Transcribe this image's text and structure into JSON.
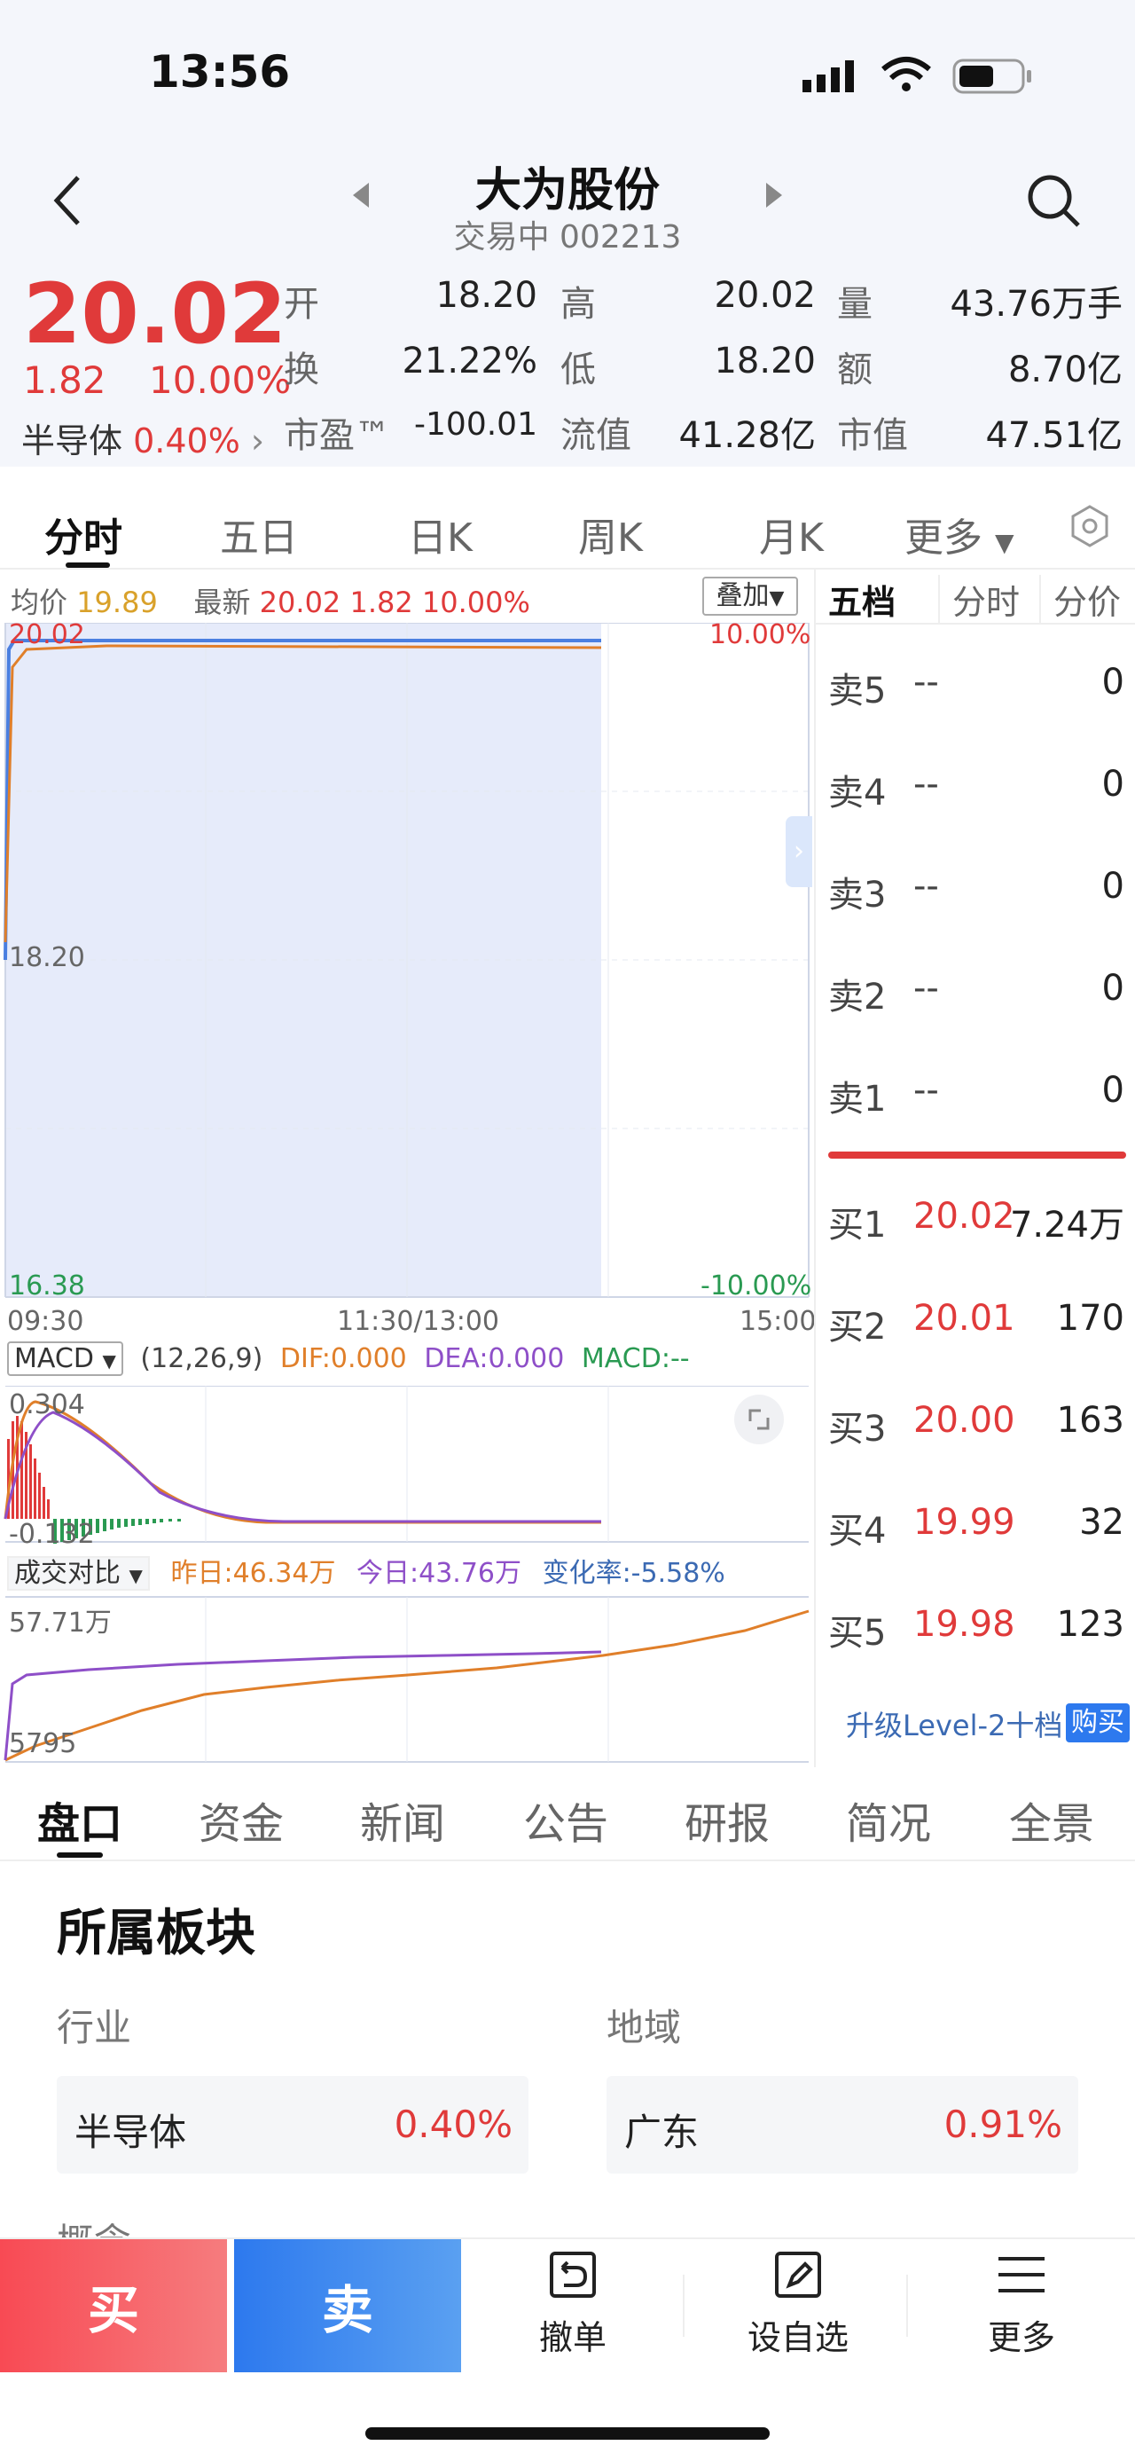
{
  "status": {
    "time": "13:56"
  },
  "nav": {
    "title": "大为股份",
    "subtitle": "交易中 002213"
  },
  "quote": {
    "price": "20.02",
    "change": "1.82",
    "change_pct": "10.00%",
    "sector_name": "半导体",
    "sector_pct": "0.40%",
    "stats": [
      {
        "label": "开",
        "value": "18.20"
      },
      {
        "label": "高",
        "value": "20.02"
      },
      {
        "label": "量",
        "value": "43.76万手"
      },
      {
        "label": "换",
        "value": "21.22%"
      },
      {
        "label": "低",
        "value": "18.20"
      },
      {
        "label": "额",
        "value": "8.70亿"
      },
      {
        "label": "市盈™",
        "value": "-100.01"
      },
      {
        "label": "流值",
        "value": "41.28亿"
      },
      {
        "label": "市值",
        "value": "47.51亿"
      }
    ]
  },
  "tabs": [
    "分时",
    "五日",
    "日K",
    "周K",
    "月K",
    "更多"
  ],
  "chart": {
    "avg_label": "均价",
    "avg_value": "19.89",
    "latest_label": "最新",
    "latest_value": "20.02",
    "latest_change": "1.82",
    "latest_pct": "10.00%",
    "overlay_btn": "叠加",
    "top_price": "20.02",
    "mid_price": "18.20",
    "low_price": "16.38",
    "top_pct": "10.00%",
    "low_pct": "-10.00%",
    "time_ticks": [
      "09:30",
      "11:30/13:00",
      "15:00"
    ],
    "macd": {
      "label": "MACD",
      "params": "(12,26,9)",
      "dif": "DIF:0.000",
      "dea": "DEA:0.000",
      "macd": "MACD:--",
      "top": "0.304",
      "bottom": "-0.132"
    },
    "volcmp": {
      "label": "成交对比",
      "yesterday": "昨日:46.34万",
      "today": "今日:43.76万",
      "rate": "变化率:-5.58%",
      "top": "57.71万",
      "bottom": "5795"
    }
  },
  "orderbook": {
    "tabs": [
      "五档",
      "分时",
      "分价"
    ],
    "asks": [
      {
        "label": "卖5",
        "price": "--",
        "vol": "0"
      },
      {
        "label": "卖4",
        "price": "--",
        "vol": "0"
      },
      {
        "label": "卖3",
        "price": "--",
        "vol": "0"
      },
      {
        "label": "卖2",
        "price": "--",
        "vol": "0"
      },
      {
        "label": "卖1",
        "price": "--",
        "vol": "0"
      }
    ],
    "bids": [
      {
        "label": "买1",
        "price": "20.02",
        "vol": "7.24万"
      },
      {
        "label": "买2",
        "price": "20.01",
        "vol": "170"
      },
      {
        "label": "买3",
        "price": "20.00",
        "vol": "163"
      },
      {
        "label": "买4",
        "price": "19.99",
        "vol": "32"
      },
      {
        "label": "买5",
        "price": "19.98",
        "vol": "123"
      }
    ],
    "upgrade_text": "升级Level-2十档",
    "purchase": "购买"
  },
  "bottom_tabs": [
    "盘口",
    "资金",
    "新闻",
    "公告",
    "研报",
    "简况",
    "全景"
  ],
  "sector": {
    "title": "所属板块",
    "industry_label": "行业",
    "region_label": "地域",
    "industry": {
      "name": "半导体",
      "pct": "0.40%"
    },
    "region": {
      "name": "广东",
      "pct": "0.91%"
    },
    "concept_label": "概念"
  },
  "actions": {
    "buy": "买",
    "sell": "卖",
    "cancel": "撤单",
    "watch": "设自选",
    "more": "更多"
  },
  "colors": {
    "up": "#e03a3a",
    "down": "#2a9a52",
    "accent": "#2d79ee"
  }
}
